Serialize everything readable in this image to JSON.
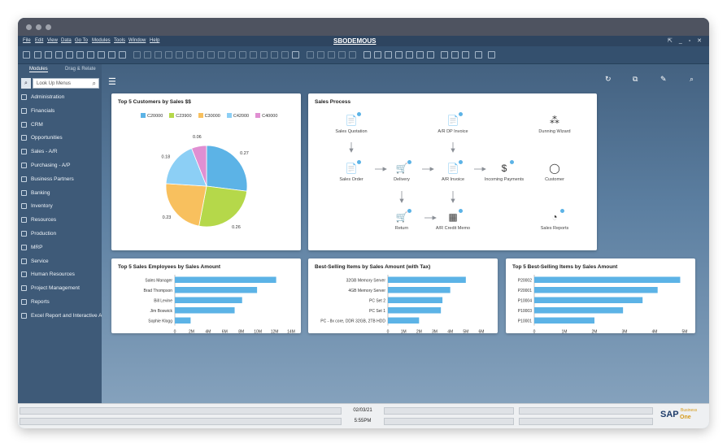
{
  "window": {
    "company": "SBODEMOUS",
    "controls": "⇱ _ ▫ ✕"
  },
  "menu": [
    "File",
    "Edit",
    "View",
    "Data",
    "Go To",
    "Modules",
    "Tools",
    "Window",
    "Help"
  ],
  "sidebar": {
    "tabs": [
      "Modules",
      "Drag & Relate"
    ],
    "search_placeholder": "Look Up Menus",
    "items": [
      "Administration",
      "Financials",
      "CRM",
      "Opportunities",
      "Sales - A/R",
      "Purchasing - A/P",
      "Business Partners",
      "Banking",
      "Inventory",
      "Resources",
      "Production",
      "MRP",
      "Service",
      "Human Resources",
      "Project Management",
      "Reports",
      "Excel Report and Interactive A"
    ]
  },
  "cards": {
    "top_customers": {
      "title": "Top 5 Customers by Sales $$"
    },
    "sales_process": {
      "title": "Sales Process",
      "nodes": [
        "Sales Quotation",
        "A/R DP Invoice",
        "Dunning Wizard",
        "Sales Order",
        "Delivery",
        "A/R Invoice",
        "Incoming Payments",
        "Customer",
        "Return",
        "A/R Credit Memo",
        "Sales Reports"
      ]
    },
    "top_employees": {
      "title": "Top 5 Sales Employees by Sales Amount"
    },
    "best_items_tax": {
      "title": "Best-Selling Items by Sales Amount (with Tax)"
    },
    "top_items": {
      "title": "Top 5 Best-Selling Items by Sales Amount"
    }
  },
  "status": {
    "date": "02/03/21",
    "time": "5:55PM"
  },
  "brand": {
    "logo": "SAP",
    "sub": "Business",
    "one": "One"
  },
  "colors": {
    "bar": "#5cb3e6",
    "accent": "#2e4560"
  },
  "chart_data": [
    {
      "type": "pie",
      "title": "Top 5 Customers by Sales $$",
      "categories": [
        "C20000",
        "C23900",
        "C30000",
        "C42000",
        "C40000"
      ],
      "values": [
        0.27,
        0.26,
        0.23,
        0.18,
        0.06
      ],
      "colors": [
        "#5cb3e6",
        "#b5d84a",
        "#f8c05e",
        "#8ccff5",
        "#e08fd2"
      ],
      "legend": "top"
    },
    {
      "type": "bar",
      "orientation": "horizontal",
      "title": "Top 5 Sales Employees by Sales Amount",
      "categories": [
        "Sales Manager",
        "Brad Thompson",
        "Bill Levine",
        "Jim Boswick",
        "Sophie Klogg"
      ],
      "values": [
        12200000,
        9900000,
        8100000,
        7200000,
        1900000
      ],
      "ticks": [
        "0",
        "2M",
        "4M",
        "6M",
        "8M",
        "10M",
        "12M",
        "14M"
      ],
      "xlim": [
        0,
        14000000
      ]
    },
    {
      "type": "bar",
      "orientation": "horizontal",
      "title": "Best-Selling Items by Sales Amount (with Tax)",
      "categories": [
        "32GB Memory Server",
        "4GB Memory Server",
        "PC Set 2",
        "PC Set 1",
        "PC - 8x core, DDR 32GB, 2TB HDD"
      ],
      "values": [
        5000000,
        4000000,
        3500000,
        3400000,
        2000000
      ],
      "ticks": [
        "0",
        "1M",
        "2M",
        "3M",
        "4M",
        "5M",
        "6M"
      ],
      "xlim": [
        0,
        6000000
      ]
    },
    {
      "type": "bar",
      "orientation": "horizontal",
      "title": "Top 5 Best-Selling Items by Sales Amount",
      "categories": [
        "P20002",
        "P20001",
        "P10004",
        "P10003",
        "P10001"
      ],
      "values": [
        4850000,
        4100000,
        3600000,
        2950000,
        2000000
      ],
      "ticks": [
        "0",
        "1M",
        "2M",
        "3M",
        "4M",
        "5M"
      ],
      "xlim": [
        0,
        5000000
      ]
    }
  ]
}
